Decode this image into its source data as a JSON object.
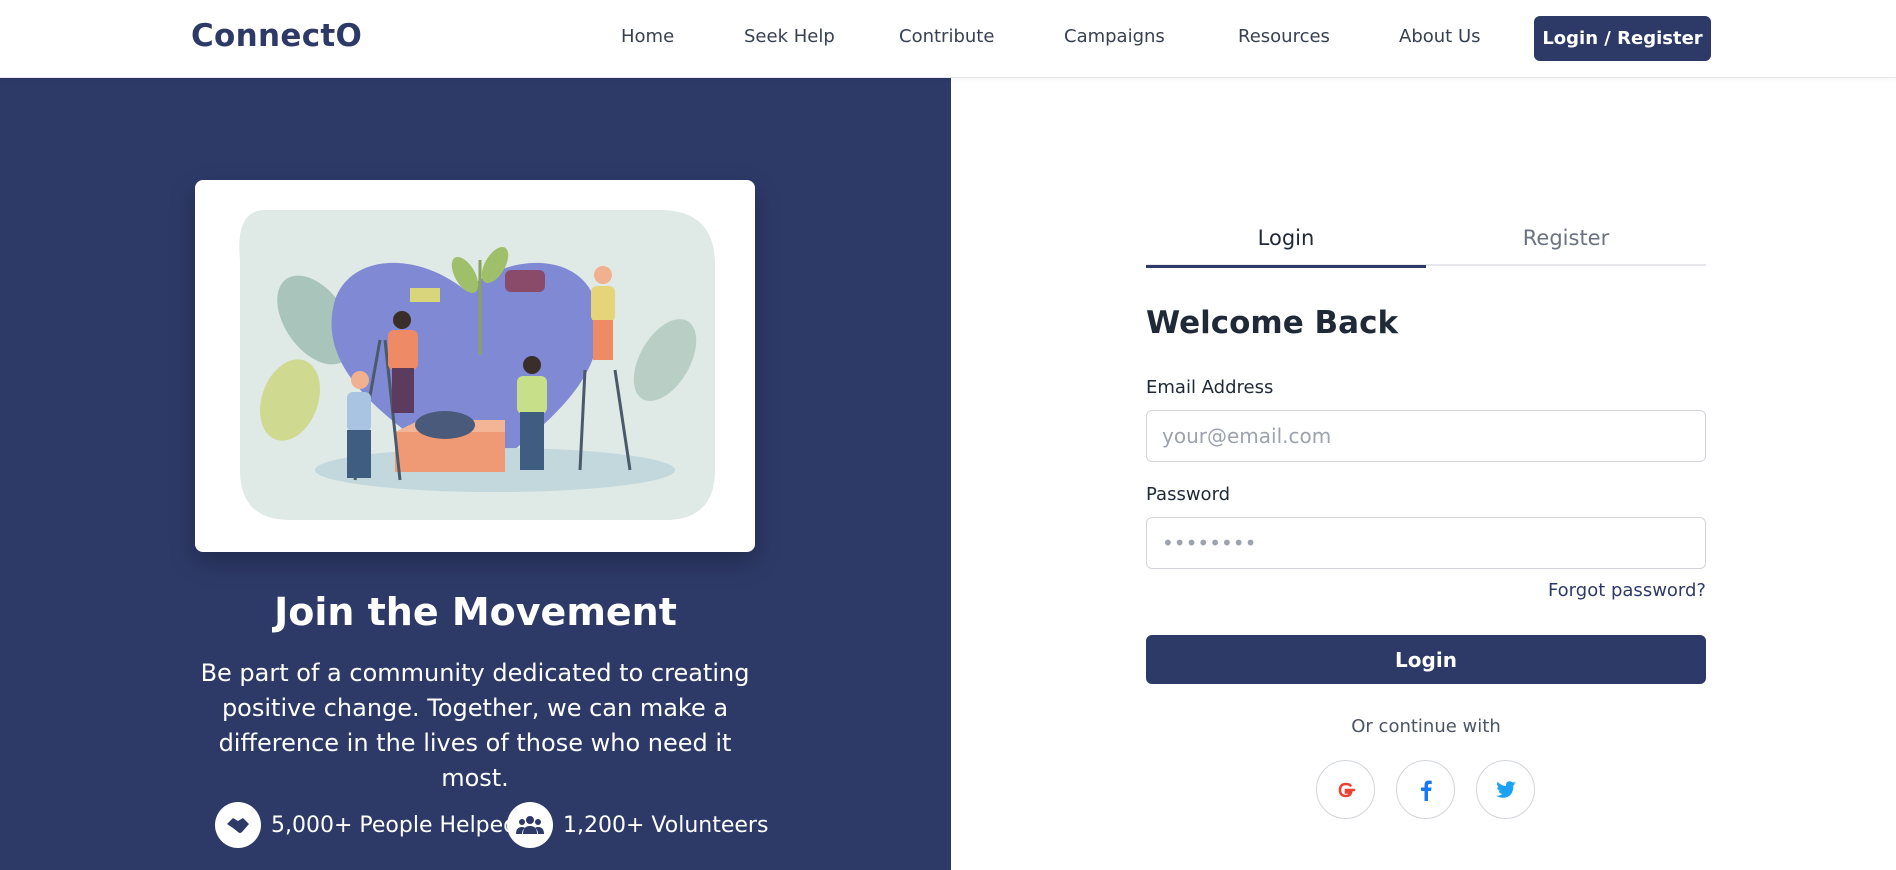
{
  "header": {
    "logo": "ConnectO",
    "nav": [
      "Home",
      "Seek Help",
      "Contribute",
      "Campaigns",
      "Resources",
      "About Us"
    ],
    "login_register": "Login / Register"
  },
  "hero": {
    "title": "Join the Movement",
    "text": "Be part of a community dedicated to creating positive change. Together, we can make a difference in the lives of those who need it most.",
    "stats": [
      {
        "icon": "handshake-icon",
        "label": "5,000+ People Helped"
      },
      {
        "icon": "users-icon",
        "label": "1,200+ Volunteers"
      }
    ]
  },
  "auth": {
    "tabs": [
      "Login",
      "Register"
    ],
    "active_tab": "Login",
    "heading": "Welcome Back",
    "email_label": "Email Address",
    "email_placeholder": "your@email.com",
    "password_label": "Password",
    "password_placeholder": "••••••••",
    "forgot": "Forgot password?",
    "submit": "Login",
    "or_text": "Or continue with",
    "social": [
      "google-icon",
      "facebook-icon",
      "twitter-icon"
    ]
  },
  "colors": {
    "brand": "#2d3a68",
    "google": "#ea4335",
    "facebook": "#1877f2",
    "twitter": "#1da1f2"
  }
}
